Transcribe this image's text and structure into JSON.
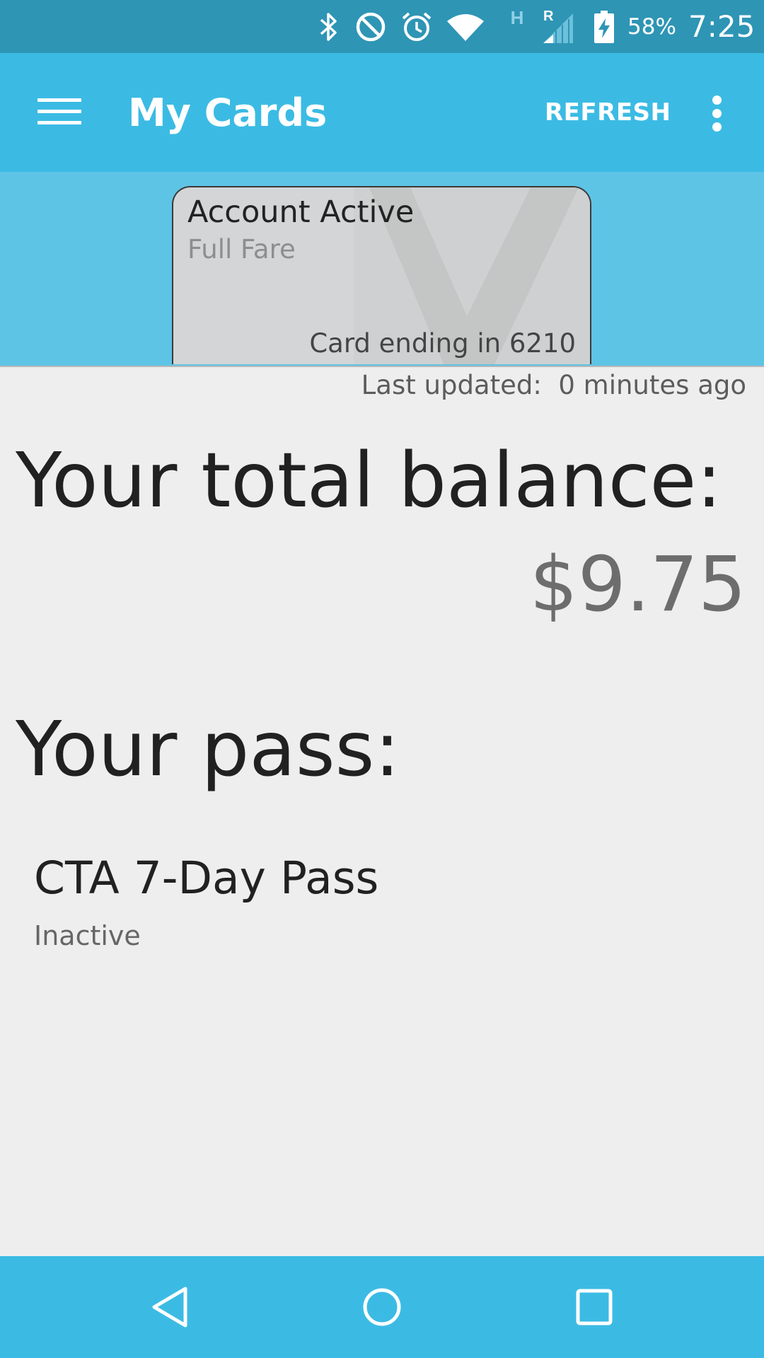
{
  "status_bar": {
    "battery_percent": "58%",
    "time": "7:25",
    "icons": [
      "bluetooth-icon",
      "do-not-disturb-icon",
      "alarm-icon",
      "wifi-icon",
      "h-network-icon",
      "roaming-signal-icon",
      "battery-charging-icon"
    ],
    "network_type": "H",
    "roaming_label": "R"
  },
  "app_bar": {
    "title": "My Cards",
    "refresh_label": "REFRESH",
    "menu_icon": "hamburger-menu-icon",
    "overflow_icon": "more-vert-icon"
  },
  "card": {
    "status": "Account Active",
    "fare_type": "Full Fare",
    "card_number_label": "Card ending in 6210"
  },
  "main": {
    "last_updated_label": "Last updated:",
    "last_updated_value": "0 minutes ago",
    "balance_heading": "Your total balance:",
    "balance_value": "$9.75",
    "pass_heading": "Your pass:",
    "passes": [
      {
        "name": "CTA 7-Day Pass",
        "status": "Inactive"
      }
    ]
  },
  "nav_bar": {
    "icons": [
      "back-icon",
      "home-icon",
      "recents-icon"
    ]
  },
  "colors": {
    "status_bar": "#2e95b5",
    "app_bar": "#3bbbe4",
    "card_strip": "#5ec4e5",
    "background": "#eeeeef"
  }
}
